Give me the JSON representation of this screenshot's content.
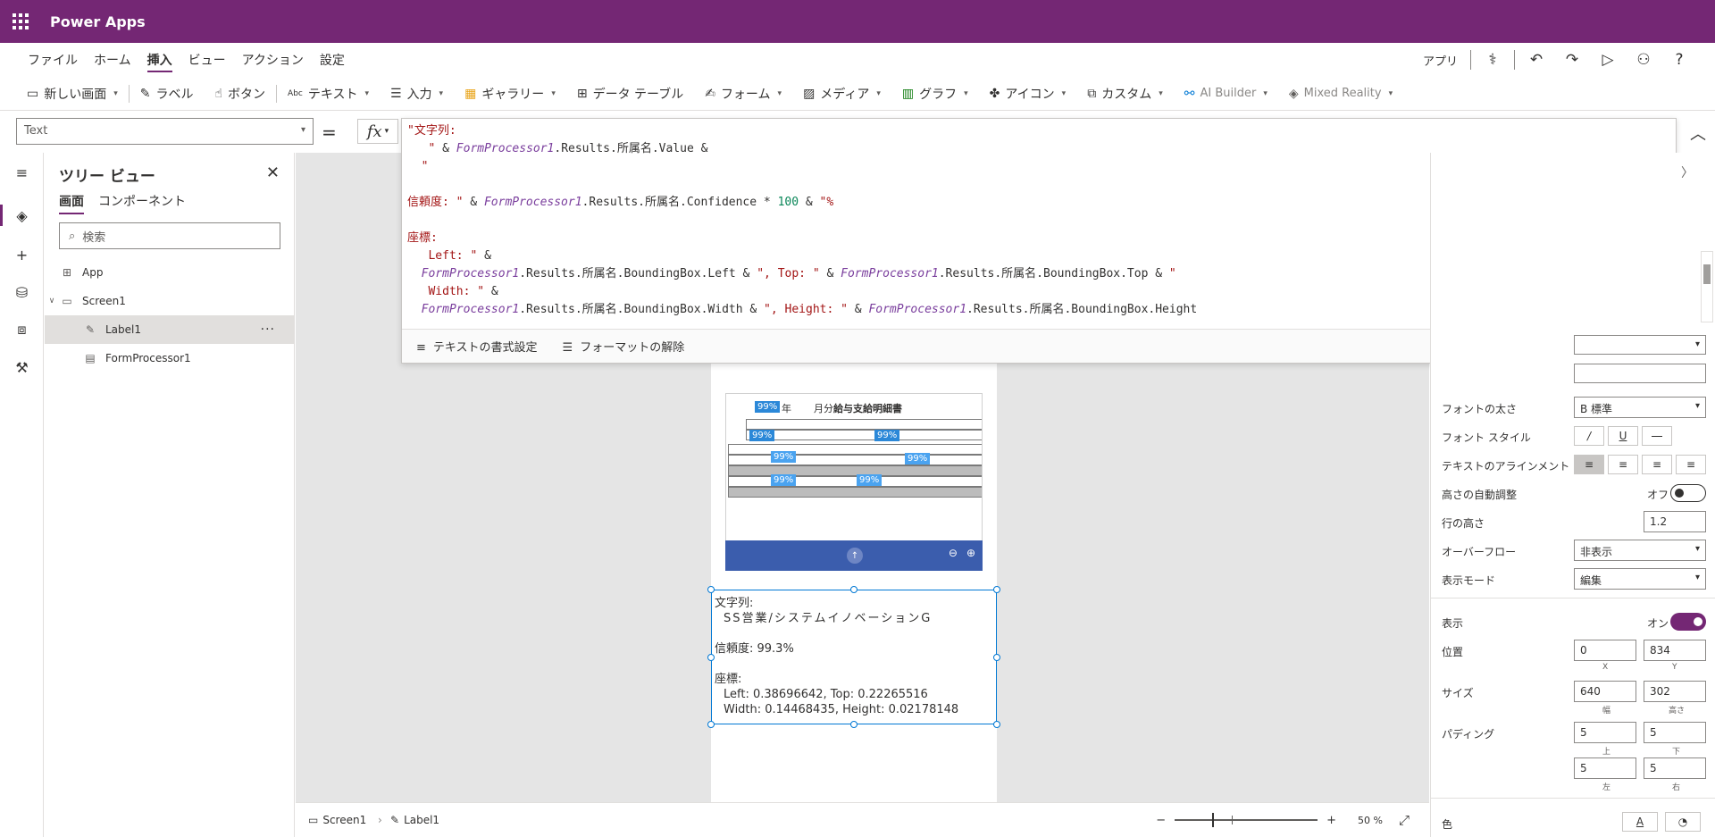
{
  "app": {
    "title": "Power Apps"
  },
  "menu": {
    "items": [
      "ファイル",
      "ホーム",
      "挿入",
      "ビュー",
      "アクション",
      "設定"
    ],
    "active": "挿入",
    "app_label": "アプリ"
  },
  "ribbon": {
    "new_screen": "新しい画面",
    "label": "ラベル",
    "button": "ボタン",
    "text": "テキスト",
    "input": "入力",
    "gallery": "ギャラリー",
    "data_table": "データ テーブル",
    "form": "フォーム",
    "media": "メディア",
    "chart": "グラフ",
    "icons": "アイコン",
    "custom": "カスタム",
    "ai_builder": "AI Builder",
    "mixed_reality": "Mixed Reality"
  },
  "formula_bar": {
    "property": "Text",
    "eq": "=",
    "fx": "fx",
    "format_text": "テキストの書式設定",
    "remove_format": "フォーマットの解除"
  },
  "tree_view": {
    "title": "ツリー ビュー",
    "tabs": [
      "画面",
      "コンポーネント"
    ],
    "search_placeholder": "検索",
    "items": [
      {
        "name": "App"
      },
      {
        "name": "Screen1"
      },
      {
        "name": "Label1"
      },
      {
        "name": "FormProcessor1"
      }
    ]
  },
  "preview": {
    "doc_nen": "年",
    "doc_bun": "月分",
    "doc_title": "給与支給明細書",
    "confidences": [
      "99%",
      "99%",
      "99%",
      "99%",
      "99%",
      "99%",
      "99%"
    ]
  },
  "label": {
    "line1": "文字列:",
    "line2": "SS営業/システムイノベーションG",
    "line3": "信頼度: 99.3%",
    "line4": "座標:",
    "line5": "Left: 0.38696642, Top: 0.22265516",
    "line6": "Width: 0.14468435, Height: 0.02178148"
  },
  "status": {
    "screen": "Screen1",
    "label": "Label1",
    "zoom": "50 %"
  },
  "properties": {
    "font_weight": {
      "label": "フォントの太さ",
      "value": "B  標準"
    },
    "font_style": {
      "label": "フォント スタイル"
    },
    "text_align": {
      "label": "テキストのアラインメント"
    },
    "auto_height": {
      "label": "高さの自動調整",
      "state": "オフ"
    },
    "line_height": {
      "label": "行の高さ",
      "value": "1.2"
    },
    "overflow": {
      "label": "オーバーフロー",
      "value": "非表示"
    },
    "display_mode": {
      "label": "表示モード",
      "value": "編集"
    },
    "visible": {
      "label": "表示",
      "state": "オン"
    },
    "position": {
      "label": "位置",
      "x": "0",
      "y": "834",
      "x_label": "X",
      "y_label": "Y"
    },
    "size": {
      "label": "サイズ",
      "w": "640",
      "h": "302",
      "w_label": "幅",
      "h_label": "高さ"
    },
    "padding": {
      "label": "パディング",
      "top": "5",
      "bottom": "5",
      "left": "5",
      "right": "5",
      "top_label": "上",
      "bottom_label": "下",
      "left_label": "左",
      "right_label": "右"
    },
    "color_label": "色"
  },
  "colors": {
    "brand": "#742774",
    "accent": "#0078d4"
  }
}
